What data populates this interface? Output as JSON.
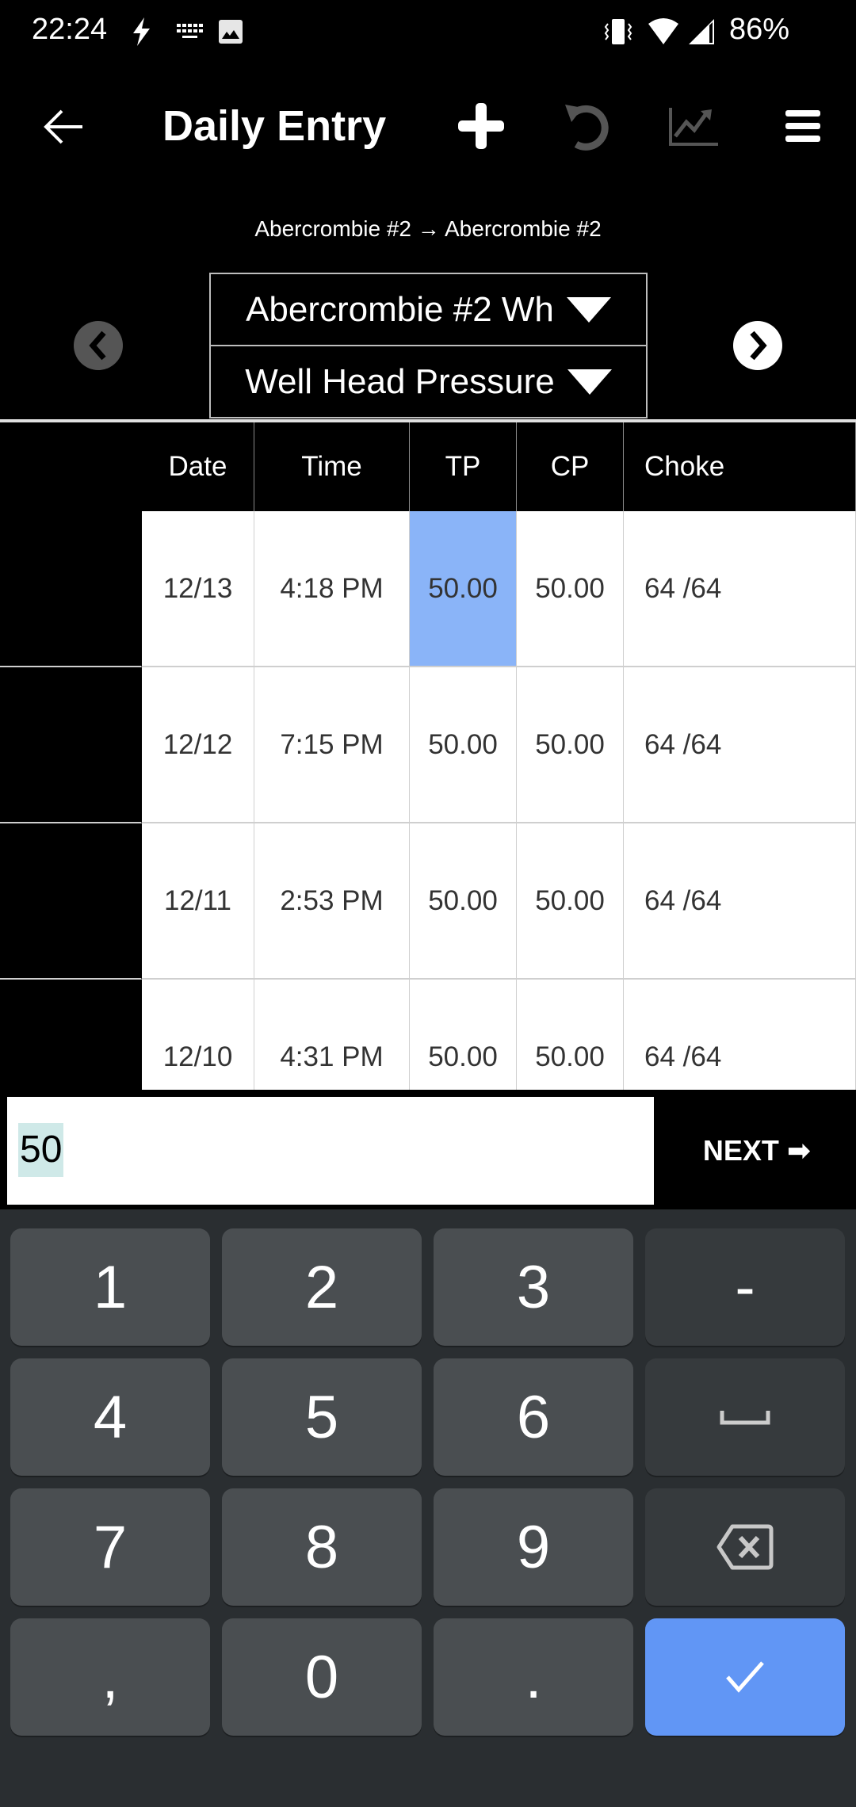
{
  "status_bar": {
    "time": "22:24",
    "left_icons": [
      "flash-icon",
      "keyboard-icon",
      "image-icon"
    ],
    "right_icons": [
      "vibrate-icon",
      "wifi-icon",
      "signal-icon"
    ],
    "battery": "86%"
  },
  "app_bar": {
    "title": "Daily Entry",
    "actions": [
      "add-icon",
      "undo-icon",
      "chart-icon",
      "menu-icon"
    ]
  },
  "route": "Abercrombie #2 → Abercrombie #2",
  "selectors": {
    "well": "Abercrombie #2 Wh",
    "measurement": "Well Head Pressure"
  },
  "table": {
    "columns": [
      "",
      "Date",
      "Time",
      "TP",
      "CP",
      "Choke"
    ],
    "rows": [
      {
        "date": "12/13",
        "time": "4:18 PM",
        "tp": "50.00",
        "cp": "50.00",
        "choke": "64 /64"
      },
      {
        "date": "12/12",
        "time": "7:15 PM",
        "tp": "50.00",
        "cp": "50.00",
        "choke": "64 /64"
      },
      {
        "date": "12/11",
        "time": "2:53 PM",
        "tp": "50.00",
        "cp": "50.00",
        "choke": "64 /64"
      },
      {
        "date": "12/10",
        "time": "4:31 PM",
        "tp": "50.00",
        "cp": "50.00",
        "choke": "64 /64"
      }
    ],
    "selected_cell": {
      "row": 0,
      "column": "TP"
    },
    "selected_color": "#8ab4f8"
  },
  "entry": {
    "value": "50",
    "next_label": "NEXT ➡"
  },
  "keyboard": {
    "keys": [
      "1",
      "2",
      "3",
      "-",
      "4",
      "5",
      "6",
      "space",
      "7",
      "8",
      "9",
      "backspace",
      ",",
      "0",
      ".",
      "enter"
    ],
    "labels": {
      "k1": "1",
      "k2": "2",
      "k3": "3",
      "minus": "-",
      "k4": "4",
      "k5": "5",
      "k6": "6",
      "k7": "7",
      "k8": "8",
      "k9": "9",
      "comma": ",",
      "k0": "0",
      "period": "."
    },
    "enter_color": "#6196f5"
  }
}
